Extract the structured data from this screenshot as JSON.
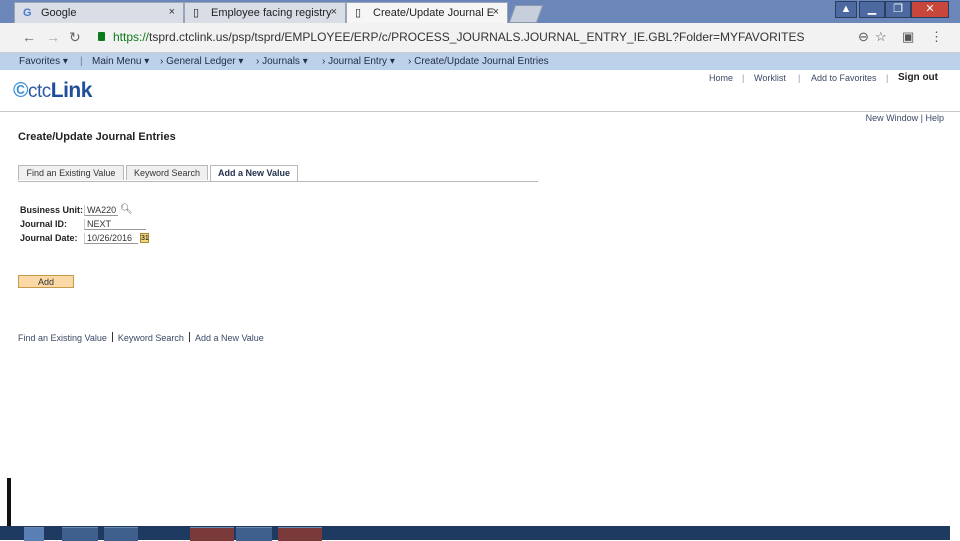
{
  "browser": {
    "tabs": [
      {
        "icon": "G",
        "label": "Google",
        "close": "×"
      },
      {
        "icon": "▯",
        "label": "Employee facing registry",
        "close": "×"
      },
      {
        "icon": "▯",
        "label": "Create/Update Journal E",
        "close": "×"
      }
    ],
    "url_scheme": "https://",
    "url_rest": "tsprd.ctclink.us/psp/tsprd/EMPLOYEE/ERP/c/PROCESS_JOURNALS.JOURNAL_ENTRY_IE.GBL?Folder=MYFAVORITES"
  },
  "menu": {
    "favorites": "Favorites",
    "main_menu": "Main Menu",
    "breadcrumb": [
      "General Ledger",
      "Journals",
      "Journal Entry",
      "Create/Update Journal Entries"
    ]
  },
  "header": {
    "logo_prefix": "ctc",
    "logo_suffix": "Link",
    "links": [
      "Home",
      "Worklist",
      "Add to Favorites"
    ],
    "sign_out": "Sign out",
    "new_window": "New Window",
    "help": "Help"
  },
  "page": {
    "title": "Create/Update Journal Entries",
    "tabs": [
      "Find an Existing Value",
      "Keyword Search",
      "Add a New Value"
    ],
    "form": {
      "business_unit_label": "Business Unit:",
      "business_unit_value": "WA220",
      "journal_id_label": "Journal ID:",
      "journal_id_value": "NEXT",
      "journal_date_label": "Journal Date:",
      "journal_date_value": "10/26/2016"
    },
    "add_button": "Add",
    "bottom_links": [
      "Find an Existing Value",
      "Keyword Search",
      "Add a New Value"
    ]
  },
  "colors": {
    "menu_bar": "#bcd1ea",
    "add_button": "#fbd9a6",
    "logo": "#1f4f9a"
  }
}
